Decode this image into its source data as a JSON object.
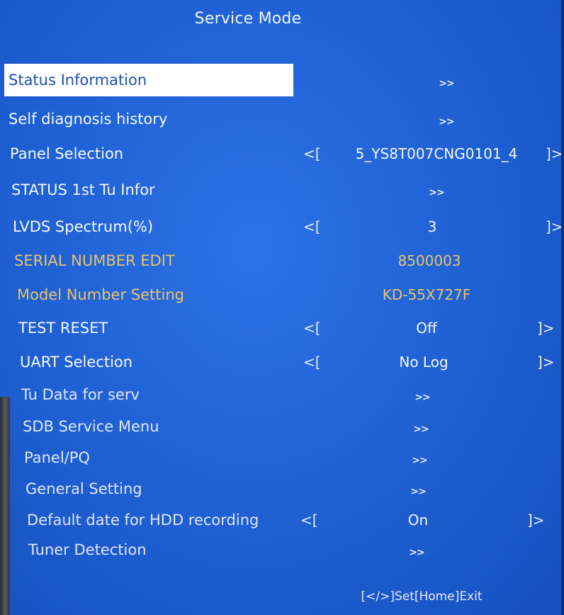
{
  "title": "Service Mode",
  "items": [
    {
      "label": "Status Information",
      "value": ">>",
      "kind": "submenu",
      "selected": true
    },
    {
      "label": "Self diagnosis history",
      "value": ">>",
      "kind": "submenu"
    },
    {
      "label": "Panel Selection",
      "value": "5_YS8T007CNG0101_4",
      "kind": "option",
      "left_bracket": "<[",
      "right_bracket": "]>"
    },
    {
      "label": "STATUS 1st Tu Infor",
      "value": ">>",
      "kind": "submenu"
    },
    {
      "label": "LVDS Spectrum(%)",
      "value": "3",
      "kind": "option",
      "left_bracket": "<[",
      "right_bracket": "]>"
    },
    {
      "label": "SERIAL NUMBER EDIT",
      "value": "8500003",
      "kind": "readonly"
    },
    {
      "label": "Model Number Setting",
      "value": "KD-55X727F",
      "kind": "readonly"
    },
    {
      "label": "TEST RESET",
      "value": "Off",
      "kind": "option",
      "left_bracket": "<[",
      "right_bracket": "]>"
    },
    {
      "label": "UART Selection",
      "value": "No Log",
      "kind": "option",
      "left_bracket": "<[",
      "right_bracket": "]>"
    },
    {
      "label": "Tu Data for serv",
      "value": ">>",
      "kind": "submenu"
    },
    {
      "label": "SDB Service Menu",
      "value": ">>",
      "kind": "submenu"
    },
    {
      "label": "Panel/PQ",
      "value": ">>",
      "kind": "submenu"
    },
    {
      "label": "General Setting",
      "value": ">>",
      "kind": "submenu"
    },
    {
      "label": "Default date for HDD recording",
      "value": "On",
      "kind": "option",
      "left_bracket": "<[",
      "right_bracket": "]>"
    },
    {
      "label": "Tuner Detection",
      "value": ">>",
      "kind": "submenu"
    }
  ],
  "footer": "[</>]Set[Home]Exit",
  "colors": {
    "background": "#1e5fd2",
    "text": "#f4f7ff",
    "readonly_text": "#e9c26a",
    "selection_bg": "#ffffff",
    "selection_text": "#1d4fb5"
  }
}
